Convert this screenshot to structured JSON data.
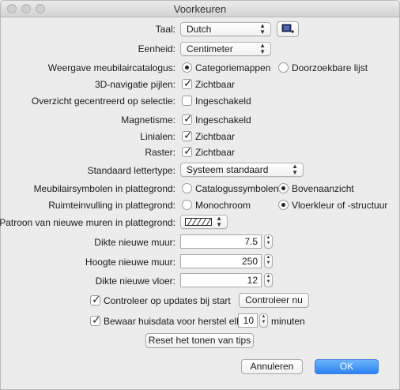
{
  "window": {
    "title": "Voorkeuren"
  },
  "language": {
    "label": "Taal:",
    "value": "Dutch"
  },
  "unit": {
    "label": "Eenheid:",
    "value": "Centimeter"
  },
  "catalog_view": {
    "label": "Weergave meubilaircatalogus:",
    "option_a": "Categoriemappen",
    "option_b": "Doorzoekbare lijst",
    "selected": "a"
  },
  "nav3d": {
    "label": "3D-navigatie pijlen:",
    "checkbox": "Zichtbaar",
    "checked": true
  },
  "centered": {
    "label": "Overzicht gecentreerd op selectie:",
    "checkbox": "Ingeschakeld",
    "checked": false
  },
  "magnetism": {
    "label": "Magnetisme:",
    "checkbox": "Ingeschakeld",
    "checked": true
  },
  "rulers": {
    "label": "Linialen:",
    "checkbox": "Zichtbaar",
    "checked": true
  },
  "grid": {
    "label": "Raster:",
    "checkbox": "Zichtbaar",
    "checked": true
  },
  "font": {
    "label": "Standaard lettertype:",
    "value": "Systeem standaard"
  },
  "furniture_icons": {
    "label": "Meubilairsymbolen in plattegrond:",
    "option_a": "Catalogussymbolen",
    "option_b": "Bovenaanzicht",
    "selected": "b"
  },
  "room_fill": {
    "label": "Ruimteinvulling in plattegrond:",
    "option_a": "Monochroom",
    "option_b": "Vloerkleur of -structuur",
    "selected": "b"
  },
  "wall_pattern": {
    "label": "Patroon van nieuwe muren in plattegrond:"
  },
  "wall_thickness": {
    "label": "Dikte nieuwe muur:",
    "value": "7.5"
  },
  "wall_height": {
    "label": "Hoogte nieuwe muur:",
    "value": "250"
  },
  "floor_thickness": {
    "label": "Dikte nieuwe vloer:",
    "value": "12"
  },
  "updates": {
    "checkbox": "Controleer op updates bij start",
    "checked": true,
    "button": "Controleer nu"
  },
  "autosave": {
    "checkbox": "Bewaar huisdata voor herstel elke:",
    "checked": true,
    "value": "10",
    "unit": "minuten"
  },
  "reset_tips": {
    "button": "Reset het tonen van tips"
  },
  "footer": {
    "cancel": "Annuleren",
    "ok": "OK"
  }
}
